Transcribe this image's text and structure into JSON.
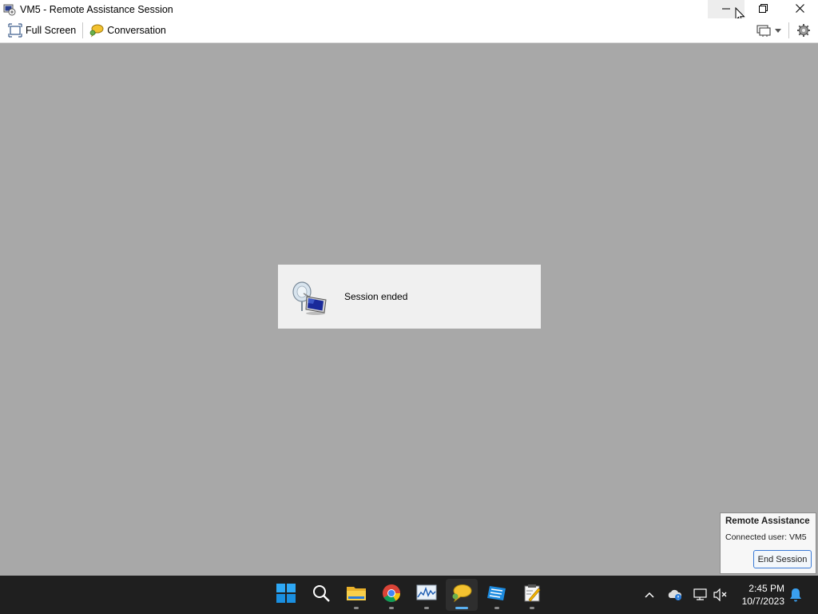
{
  "window": {
    "title": "VM5 - Remote Assistance Session",
    "icon": "remote-assistance-app-icon"
  },
  "title_controls": [
    "minimize-icon",
    "restore-icon",
    "close-icon"
  ],
  "toolbar": {
    "full_screen_label": "Full Screen",
    "conversation_label": "Conversation",
    "right_icons": [
      "display-settings-icon",
      "chevron-down-icon",
      "gear-icon"
    ]
  },
  "session": {
    "message": "Session ended",
    "icon": "remote-computer-satellite-icon"
  },
  "notification": {
    "title": "Remote Assistance",
    "connected_user": "Connected user:  VM5",
    "end_button_label": "End Session"
  },
  "taskbar": {
    "apps": [
      {
        "name": "start-button",
        "icon": "windows-logo-icon"
      },
      {
        "name": "search",
        "icon": "search-icon"
      },
      {
        "name": "file-explorer",
        "icon": "folder-icon"
      },
      {
        "name": "chrome",
        "icon": "chrome-icon"
      },
      {
        "name": "task-manager",
        "icon": "performance-monitor-icon"
      },
      {
        "name": "remote-assistance",
        "icon": "chat-bubble-icon",
        "active": true
      },
      {
        "name": "app-blue",
        "icon": "blue-app-icon"
      },
      {
        "name": "app-clipboard",
        "icon": "notepad-app-icon"
      }
    ],
    "tray_icons": [
      "chevron-up-icon",
      "onedrive-cloud-icon",
      "network-icon",
      "volume-muted-icon",
      "notification-bell-icon"
    ],
    "time": "2:45 PM",
    "date": "10/7/2023"
  },
  "colors": {
    "session_background": "#a8a8a8",
    "dialog_background": "#f0f0f0",
    "taskbar": "#1f1f1f",
    "accent": "#3a7ad6"
  }
}
